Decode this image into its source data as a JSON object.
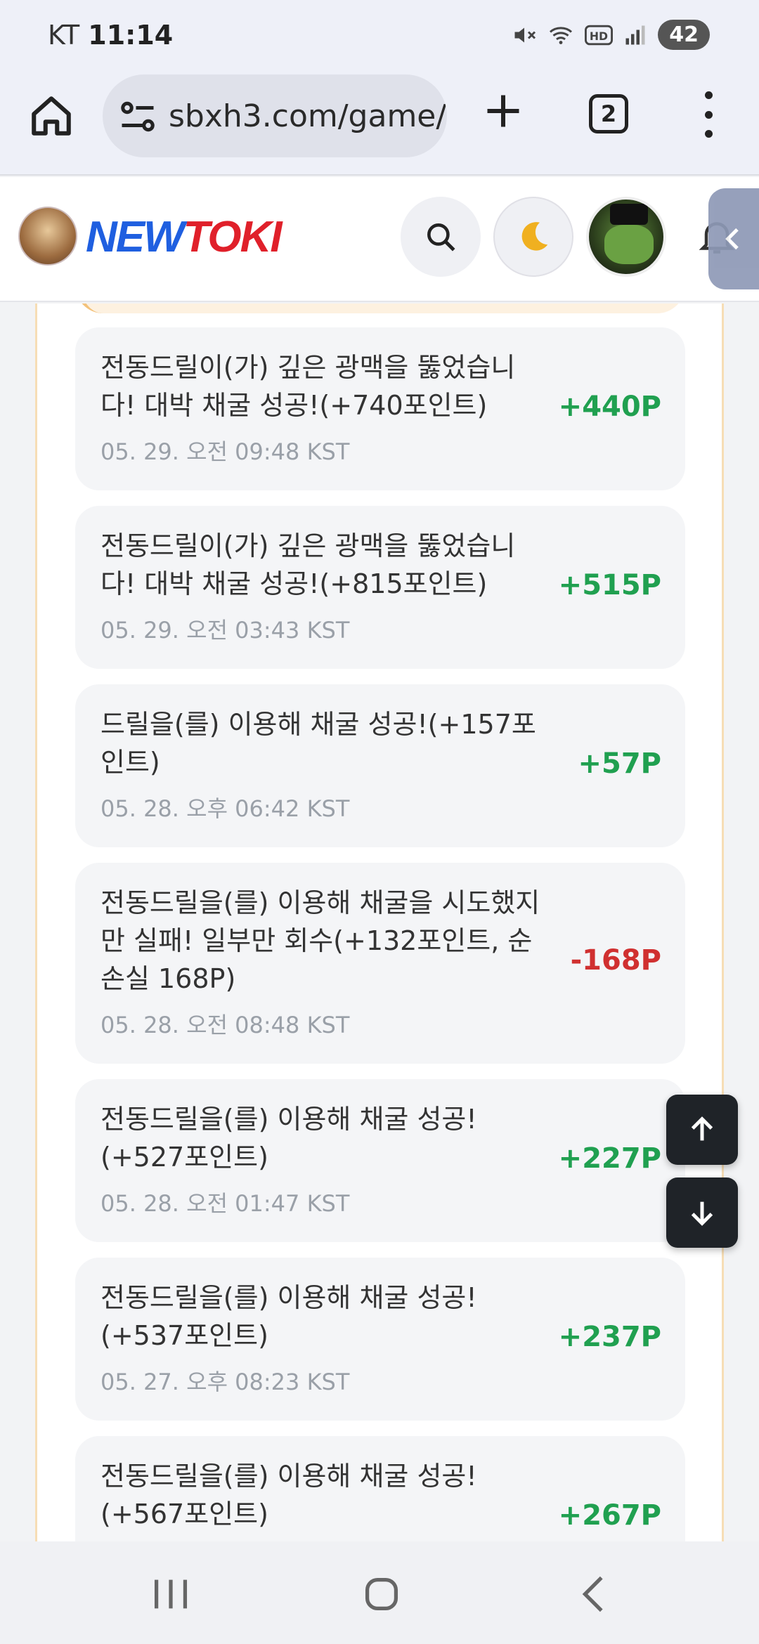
{
  "status_bar": {
    "carrier": "KT",
    "time": "11:14",
    "battery": "42",
    "icons": [
      "mute-icon",
      "wifi-icon",
      "hd-icon",
      "signal-icon"
    ]
  },
  "browser": {
    "url": "sbxh3.com/game/",
    "tab_count": "2"
  },
  "site": {
    "logo_new": "NEW",
    "logo_toki": "TOKI",
    "accent_blue": "#1f5fe0",
    "accent_red": "#e0202a"
  },
  "log_items": [
    {
      "message": "전동드릴이(가) 깊은 광맥을 뚫었습니다! 대박 채굴 성공!(+740포인트)",
      "time": "05. 29. 오전 09:48 KST",
      "points": "+440P",
      "status": "positive"
    },
    {
      "message": "전동드릴이(가) 깊은 광맥을 뚫었습니다! 대박 채굴 성공!(+815포인트)",
      "time": "05. 29. 오전 03:43 KST",
      "points": "+515P",
      "status": "positive"
    },
    {
      "message": "드릴을(를) 이용해 채굴 성공!(+157포인트)",
      "time": "05. 28. 오후 06:42 KST",
      "points": "+57P",
      "status": "positive"
    },
    {
      "message": "전동드릴을(를) 이용해 채굴을 시도했지만 실패! 일부만 회수(+132포인트, 순손실 168P)",
      "time": "05. 28. 오전 08:48 KST",
      "points": "-168P",
      "status": "negative"
    },
    {
      "message": "전동드릴을(를) 이용해 채굴 성공!(+527포인트)",
      "time": "05. 28. 오전 01:47 KST",
      "points": "+227P",
      "status": "positive"
    },
    {
      "message": "전동드릴을(를) 이용해 채굴 성공!(+537포인트)",
      "time": "05. 27. 오후 08:23 KST",
      "points": "+237P",
      "status": "positive"
    },
    {
      "message": "전동드릴을(를) 이용해 채굴 성공!(+567포인트)",
      "time": "",
      "points": "+267P",
      "status": "positive"
    }
  ],
  "colors": {
    "positive": "#20a050",
    "negative": "#d03030"
  }
}
